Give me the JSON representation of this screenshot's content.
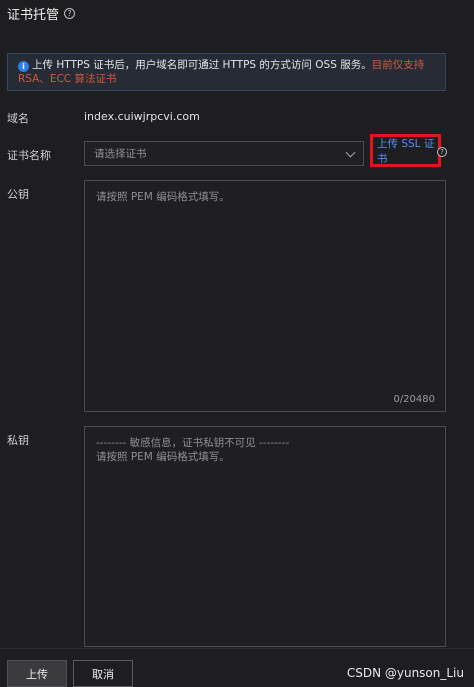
{
  "header": {
    "title": "证书托管",
    "help_glyph": "?"
  },
  "alert": {
    "icon": "i",
    "text": "上传 HTTPS 证书后，用户域名即可通过 HTTPS 的方式访问 OSS 服务。",
    "warning": "目前仅支持 RSA、ECC 算法证书"
  },
  "form": {
    "domain_label": "域名",
    "domain_value": "index.cuiwjrpcvi.com",
    "cert_name_label": "证书名称",
    "cert_select_placeholder": "请选择证书",
    "upload_ssl_link": "上传 SSL 证书",
    "upload_help_glyph": "?",
    "public_key_label": "公钥",
    "public_key_placeholder": "请按照 PEM 编码格式填写。",
    "public_key_counter": "0/20480",
    "private_key_label": "私钥",
    "private_key_line1": "-------- 敏感信息，证书私钥不可见 --------",
    "private_key_line2": "请按照 PEM 编码格式填写。"
  },
  "footer": {
    "upload_button": "上传",
    "cancel_button": "取消"
  },
  "watermark": "CSDN @yunson_Liu",
  "colors": {
    "background": "#1e1e21",
    "link": "#4d93f5",
    "warning": "#d2583c",
    "highlight_box": "#e0161c",
    "info_icon": "#2b7de9"
  }
}
